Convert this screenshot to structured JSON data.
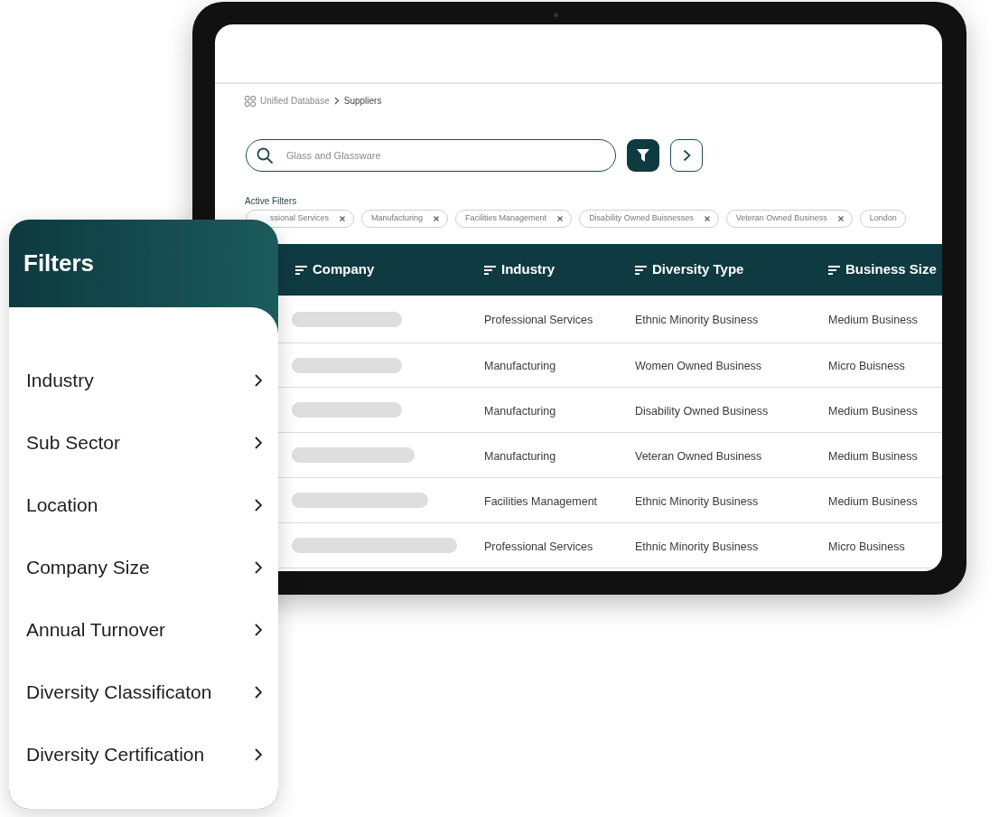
{
  "breadcrumb": [
    {
      "label": "Unified Database"
    },
    {
      "label": "Suppliers"
    }
  ],
  "search": {
    "placeholder": "Glass and Glassware"
  },
  "active_filters": {
    "label": "Active Filters",
    "chips": [
      {
        "label": "ssional Services",
        "removable": true
      },
      {
        "label": "Manufacturing",
        "removable": true
      },
      {
        "label": "Facilities Management",
        "removable": true
      },
      {
        "label": "Disability Owned Buisnesses",
        "removable": true
      },
      {
        "label": "Veteran Owned Business",
        "removable": true
      },
      {
        "label": "London",
        "removable": false
      }
    ]
  },
  "table": {
    "columns": [
      "Company",
      "Industry",
      "Diversity Type",
      "Business Size"
    ],
    "rows": [
      {
        "industry": "Professional Services",
        "diversity_type": "Ethnic Minority Business",
        "business_size": "Medium Business"
      },
      {
        "industry": "Manufacturing",
        "diversity_type": "Women Owned Business",
        "business_size": "Micro Buisness"
      },
      {
        "industry": "Manufacturing",
        "diversity_type": "Disability Owned Business",
        "business_size": "Medium Business"
      },
      {
        "industry": "Manufacturing",
        "diversity_type": "Veteran Owned Business",
        "business_size": "Medium Business"
      },
      {
        "industry": "Facilities Management",
        "diversity_type": "Ethnic Minority Business",
        "business_size": "Medium Business"
      },
      {
        "industry": "Professional Services",
        "diversity_type": "Ethnic Minority Business",
        "business_size": "Micro Business"
      }
    ]
  },
  "filters_panel": {
    "title": "Filters",
    "items": [
      "Industry",
      "Sub Sector",
      "Location",
      "Company Size",
      "Annual Turnover",
      "Diversity Classificaton",
      "Diversity Certification"
    ]
  }
}
